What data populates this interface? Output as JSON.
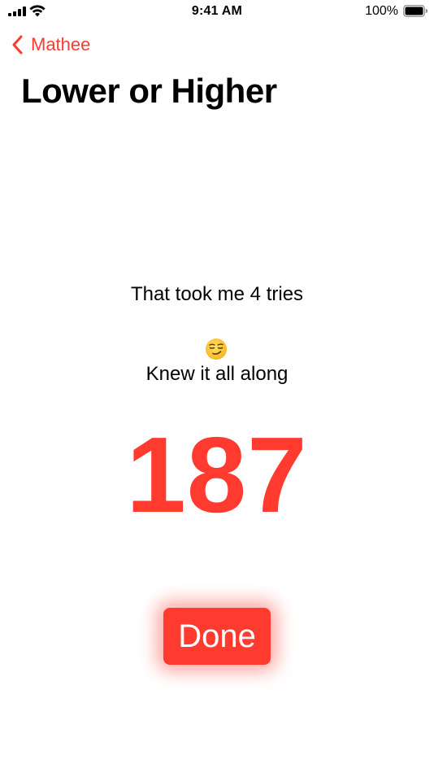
{
  "status_bar": {
    "time": "9:41 AM",
    "battery_percent": "100%",
    "battery_level": 1.0
  },
  "nav": {
    "back_label": "Mathee"
  },
  "page": {
    "title": "Lower or Higher"
  },
  "result": {
    "tries_text": "That took me 4 tries",
    "emoji": "smirking-face-icon",
    "comment": "Knew it all along",
    "number": "187"
  },
  "actions": {
    "done_label": "Done"
  },
  "colors": {
    "accent": "#ff3b30",
    "text": "#000000",
    "background": "#ffffff"
  }
}
